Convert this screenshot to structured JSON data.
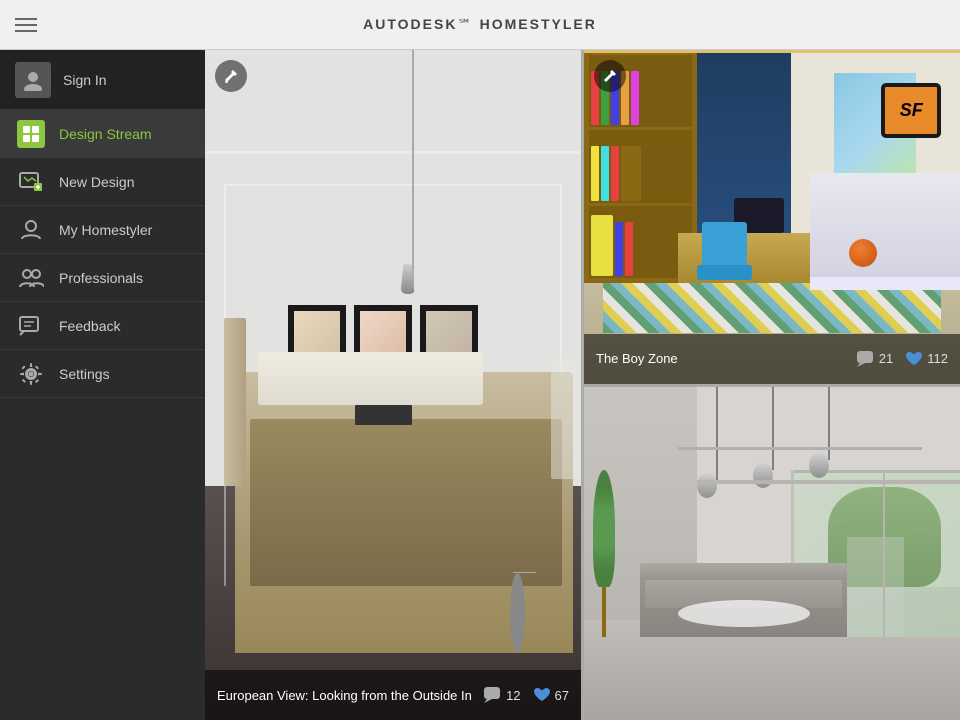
{
  "header": {
    "title_prefix": "AUTODESK",
    "title_suffix": "HOMESTYLER",
    "menu_icon_label": "menu"
  },
  "sidebar": {
    "sign_in_label": "Sign In",
    "items": [
      {
        "id": "design-stream",
        "label": "Design Stream",
        "active": true
      },
      {
        "id": "new-design",
        "label": "New Design",
        "active": false
      },
      {
        "id": "my-homestyler",
        "label": "My Homestyler",
        "active": false
      },
      {
        "id": "professionals",
        "label": "Professionals",
        "active": false
      },
      {
        "id": "feedback",
        "label": "Feedback",
        "active": false
      },
      {
        "id": "settings",
        "label": "Settings",
        "active": false
      }
    ]
  },
  "designs": {
    "large": {
      "title": "European View: Looking from the Outside In",
      "comments": "12",
      "likes": "67"
    },
    "top_right": {
      "title": "The Boy Zone",
      "comments": "21",
      "likes": "112"
    },
    "bottom_right": {
      "title": "",
      "comments": "",
      "likes": ""
    }
  },
  "icons": {
    "menu": "☰",
    "chat_bubble": "💬",
    "heart": "♥",
    "edit": "✏",
    "person": "👤"
  }
}
